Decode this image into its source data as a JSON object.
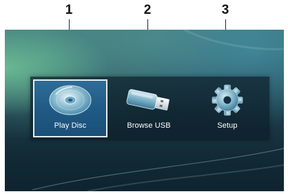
{
  "callouts": [
    {
      "number": "1"
    },
    {
      "number": "2"
    },
    {
      "number": "3"
    }
  ],
  "menu": {
    "selected_index": 0,
    "items": [
      {
        "label": "Play Disc",
        "icon": "disc-icon"
      },
      {
        "label": "Browse USB",
        "icon": "usb-drive-icon"
      },
      {
        "label": "Setup",
        "icon": "gear-icon"
      }
    ]
  },
  "colors": {
    "selection_fill": "#1f5984",
    "selection_border": "#e8eef2",
    "menu_text": "#ffffff",
    "screen_dark": "#122a35",
    "screen_glow": "#70c496"
  }
}
